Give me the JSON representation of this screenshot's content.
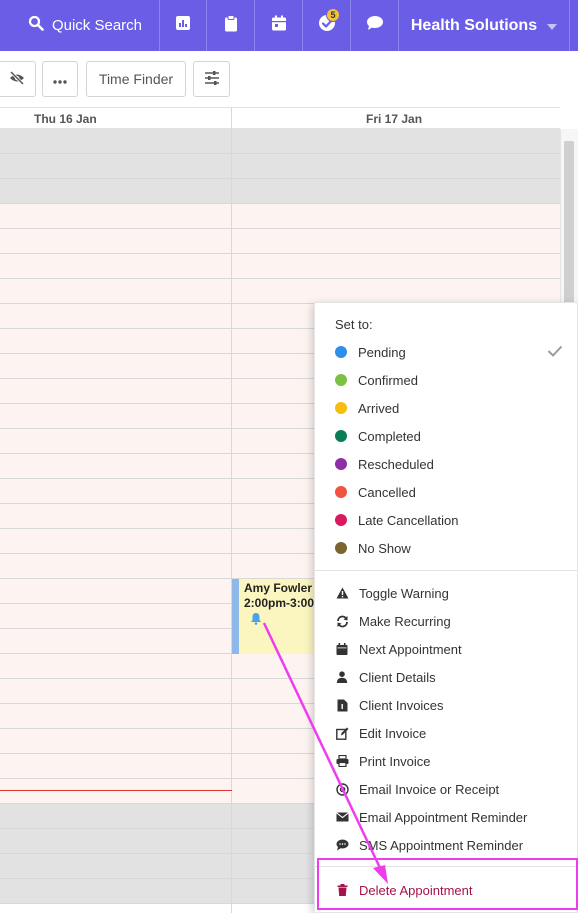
{
  "topbar": {
    "search_label": "Quick Search",
    "badge_count": "5",
    "org_name": "Health Solutions",
    "icons": [
      "search-icon",
      "reports-icon",
      "clipboard-icon",
      "calendar-icon",
      "check-circle-icon",
      "chat-icon",
      "caret-down-icon"
    ]
  },
  "toolbar": {
    "time_finder_label": "Time Finder"
  },
  "calendar": {
    "days": [
      "Thu 16 Jan",
      "Fri 17 Jan"
    ]
  },
  "appointment": {
    "client": "Amy Fowler",
    "time": "2:00pm-3:00",
    "color": "#fbf6bf"
  },
  "menu": {
    "title": "Set to:",
    "statuses": [
      {
        "label": "Pending",
        "color": "#2f8fe8",
        "selected": true
      },
      {
        "label": "Confirmed",
        "color": "#7dc142"
      },
      {
        "label": "Arrived",
        "color": "#f8bd0f"
      },
      {
        "label": "Completed",
        "color": "#0b7d54"
      },
      {
        "label": "Rescheduled",
        "color": "#8e2fa6"
      },
      {
        "label": "Cancelled",
        "color": "#f25340"
      },
      {
        "label": "Late Cancellation",
        "color": "#d81b60"
      },
      {
        "label": "No Show",
        "color": "#7a6430"
      }
    ],
    "actions": [
      {
        "label": "Toggle Warning",
        "icon": "warning-icon"
      },
      {
        "label": "Make Recurring",
        "icon": "recurring-icon"
      },
      {
        "label": "Next Appointment",
        "icon": "calendar-icon"
      },
      {
        "label": "Client Details",
        "icon": "user-icon"
      },
      {
        "label": "Client Invoices",
        "icon": "invoice-file-icon"
      },
      {
        "label": "Edit Invoice",
        "icon": "edit-icon"
      },
      {
        "label": "Print Invoice",
        "icon": "print-icon"
      },
      {
        "label": "Email Invoice or Receipt",
        "icon": "at-sign-icon"
      },
      {
        "label": "Email Appointment Reminder",
        "icon": "envelope-icon"
      },
      {
        "label": "SMS Appointment Reminder",
        "icon": "sms-icon"
      }
    ],
    "delete_label": "Delete Appointment"
  },
  "colors": {
    "topbar": "#6a5ee6",
    "highlight": "#f03cf0",
    "delete": "#a3144a"
  }
}
